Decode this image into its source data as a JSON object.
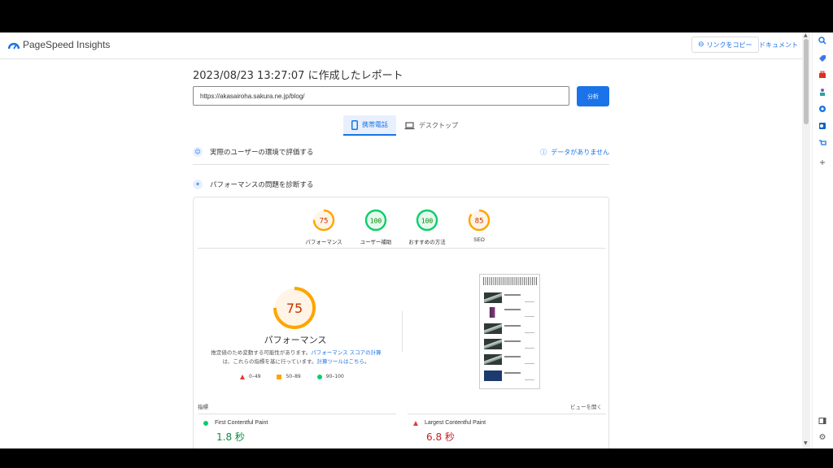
{
  "header": {
    "app_title": "PageSpeed Insights",
    "copy_link_label": "リンクをコピー",
    "docs_label": "ドキュメント"
  },
  "report": {
    "title": "2023/08/23 13:27:07 に作成したレポート",
    "url_value": "https://akasairoha.sakura.ne.jp/blog/",
    "analyze_label": "分析"
  },
  "device_tabs": [
    {
      "label": "携帯電話",
      "active": true
    },
    {
      "label": "デスクトップ",
      "active": false
    }
  ],
  "field_data": {
    "label": "実際のユーザーの環境で評価する",
    "no_data_label": "データがありません"
  },
  "lab": {
    "label": "パフォーマンスの問題を診断する"
  },
  "categories": [
    {
      "label": "パフォーマンス",
      "score": "75",
      "color": "#ffa400"
    },
    {
      "label": "ユーザー補助",
      "score": "100",
      "color": "#0cce6b"
    },
    {
      "label": "おすすめの方法",
      "score": "100",
      "color": "#0cce6b"
    },
    {
      "label": "SEO",
      "score": "85",
      "color": "#ffa400"
    }
  ],
  "performance": {
    "score": "75",
    "title": "パフォーマンス",
    "desc_part1": "推定値のため変動する可能性があります。",
    "desc_link1": "パフォーマンス スコアの計算",
    "desc_part2": "は、これらの指標を基に行っています。",
    "desc_link2": "計算ツールはこちら",
    "desc_end": "。"
  },
  "legend": [
    {
      "label": "0–49",
      "shape": "triangle",
      "color": "#e53935"
    },
    {
      "label": "50–89",
      "shape": "square",
      "color": "#ffa400"
    },
    {
      "label": "90–100",
      "shape": "circle",
      "color": "#0cce6b"
    }
  ],
  "metrics": {
    "heading": "指標",
    "view_toggle": "ビューを開く",
    "items": [
      {
        "name": "First Contentful Paint",
        "value": "1.8 秒",
        "status": "good",
        "color": "#0c8a40"
      },
      {
        "name": "Largest Contentful Paint",
        "value": "6.8 秒",
        "status": "poor",
        "color": "#c5221f"
      }
    ]
  },
  "colors": {
    "accent": "#1a73e8",
    "average": "#ffa400",
    "pass": "#0cce6b",
    "fail": "#e53935"
  }
}
